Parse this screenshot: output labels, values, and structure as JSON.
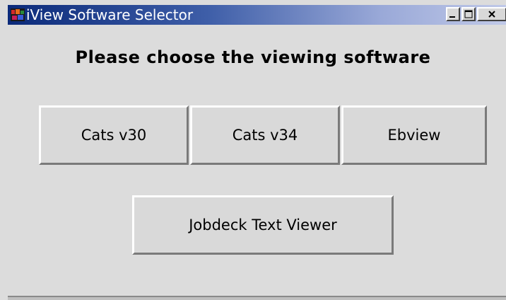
{
  "window": {
    "title": "iView Software Selector",
    "icon": "app-icon",
    "controls": {
      "minimize": "minimize-icon",
      "maximize": "maximize-icon",
      "close": "close-icon"
    }
  },
  "main": {
    "heading": "Please choose the viewing software",
    "buttons": [
      {
        "label": "Cats v30"
      },
      {
        "label": "Cats v34"
      },
      {
        "label": "Ebview"
      },
      {
        "label": "Jobdeck Text Viewer"
      }
    ]
  },
  "colors": {
    "titlebar_start": "#0b2a7a",
    "titlebar_end": "#c0c9e8",
    "background": "#dcdcdc"
  }
}
